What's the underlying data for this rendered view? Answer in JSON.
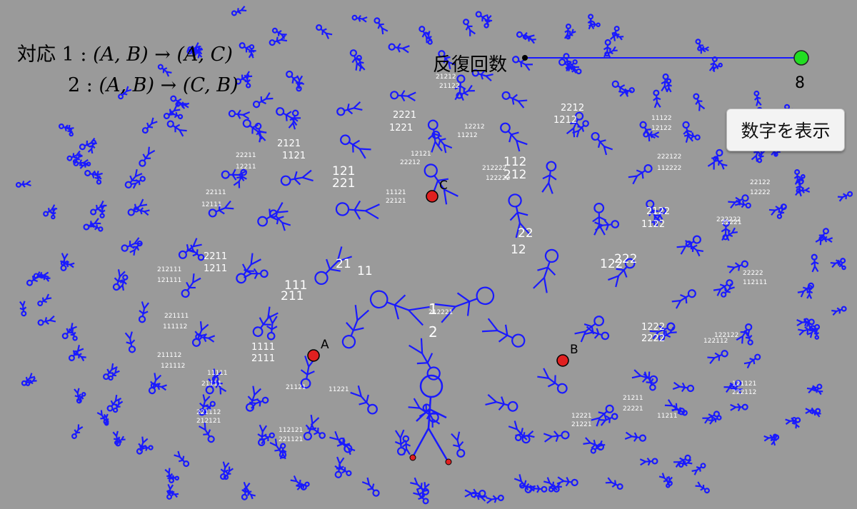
{
  "correspondence": {
    "label": "対応",
    "line1": {
      "num": "1",
      "from": "(A, B)",
      "arrow": "→",
      "to": "(A, C)"
    },
    "line2": {
      "num": "2",
      "from": "(A, B)",
      "arrow": "→",
      "to": "(C, B)"
    }
  },
  "slider": {
    "label": "反復回数",
    "value": "8",
    "handle_color": "#22dd22"
  },
  "button": {
    "label": "数字を表示"
  },
  "points": [
    {
      "name": "A",
      "color": "#e02020"
    },
    {
      "name": "B",
      "color": "#e02020"
    },
    {
      "name": "C",
      "color": "#e02020"
    }
  ],
  "figure_color": "#1a1aff",
  "labels": [
    "1",
    "2",
    "11",
    "21",
    "12",
    "22",
    "111",
    "211",
    "121",
    "221",
    "112",
    "212",
    "122",
    "222",
    "1111",
    "2111",
    "2211",
    "1211",
    "2221",
    "1221",
    "2121",
    "1121",
    "2212",
    "1212",
    "2122",
    "1122",
    "1222",
    "2222",
    "11111",
    "21111",
    "22111",
    "12111",
    "22211",
    "12211",
    "11211",
    "21211",
    "22221",
    "12221",
    "21221",
    "11221",
    "21121",
    "11121",
    "22121",
    "12121",
    "22212",
    "12212",
    "11212",
    "21212",
    "21122",
    "11122",
    "12122",
    "22122",
    "12222",
    "22222",
    "112111",
    "212111",
    "121111",
    "221111",
    "111112",
    "211112",
    "121112",
    "221112",
    "212121",
    "112121",
    "221121",
    "121121",
    "222112",
    "122112",
    "122122",
    "222122",
    "112222",
    "212222",
    "122222",
    "222222",
    "22221",
    "212221"
  ]
}
